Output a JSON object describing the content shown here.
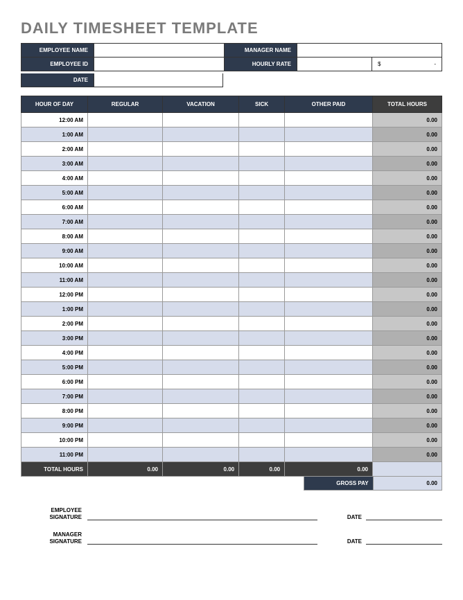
{
  "title": "DAILY TIMESHEET TEMPLATE",
  "info": {
    "employeeNameLabel": "EMPLOYEE NAME",
    "employeeName": "",
    "managerNameLabel": "MANAGER NAME",
    "managerName": "",
    "employeeIdLabel": "EMPLOYEE ID",
    "employeeId": "",
    "hourlyRateLabel": "HOURLY RATE",
    "hourlyRateSymbol": "$",
    "hourlyRateDash": "-",
    "dateLabel": "DATE",
    "date": ""
  },
  "columns": {
    "hour": "HOUR OF DAY",
    "regular": "REGULAR",
    "vacation": "VACATION",
    "sick": "SICK",
    "other": "OTHER PAID",
    "total": "TOTAL HOURS"
  },
  "rows": [
    {
      "hour": "12:00 AM",
      "reg": "",
      "vac": "",
      "sick": "",
      "other": "",
      "total": "0.00"
    },
    {
      "hour": "1:00 AM",
      "reg": "",
      "vac": "",
      "sick": "",
      "other": "",
      "total": "0.00"
    },
    {
      "hour": "2:00 AM",
      "reg": "",
      "vac": "",
      "sick": "",
      "other": "",
      "total": "0.00"
    },
    {
      "hour": "3:00 AM",
      "reg": "",
      "vac": "",
      "sick": "",
      "other": "",
      "total": "0.00"
    },
    {
      "hour": "4:00 AM",
      "reg": "",
      "vac": "",
      "sick": "",
      "other": "",
      "total": "0.00"
    },
    {
      "hour": "5:00 AM",
      "reg": "",
      "vac": "",
      "sick": "",
      "other": "",
      "total": "0.00"
    },
    {
      "hour": "6:00 AM",
      "reg": "",
      "vac": "",
      "sick": "",
      "other": "",
      "total": "0.00"
    },
    {
      "hour": "7:00 AM",
      "reg": "",
      "vac": "",
      "sick": "",
      "other": "",
      "total": "0.00"
    },
    {
      "hour": "8:00 AM",
      "reg": "",
      "vac": "",
      "sick": "",
      "other": "",
      "total": "0.00"
    },
    {
      "hour": "9:00 AM",
      "reg": "",
      "vac": "",
      "sick": "",
      "other": "",
      "total": "0.00"
    },
    {
      "hour": "10:00 AM",
      "reg": "",
      "vac": "",
      "sick": "",
      "other": "",
      "total": "0.00"
    },
    {
      "hour": "11:00 AM",
      "reg": "",
      "vac": "",
      "sick": "",
      "other": "",
      "total": "0.00"
    },
    {
      "hour": "12:00 PM",
      "reg": "",
      "vac": "",
      "sick": "",
      "other": "",
      "total": "0.00"
    },
    {
      "hour": "1:00 PM",
      "reg": "",
      "vac": "",
      "sick": "",
      "other": "",
      "total": "0.00"
    },
    {
      "hour": "2:00 PM",
      "reg": "",
      "vac": "",
      "sick": "",
      "other": "",
      "total": "0.00"
    },
    {
      "hour": "3:00 PM",
      "reg": "",
      "vac": "",
      "sick": "",
      "other": "",
      "total": "0.00"
    },
    {
      "hour": "4:00 PM",
      "reg": "",
      "vac": "",
      "sick": "",
      "other": "",
      "total": "0.00"
    },
    {
      "hour": "5:00 PM",
      "reg": "",
      "vac": "",
      "sick": "",
      "other": "",
      "total": "0.00"
    },
    {
      "hour": "6:00 PM",
      "reg": "",
      "vac": "",
      "sick": "",
      "other": "",
      "total": "0.00"
    },
    {
      "hour": "7:00 PM",
      "reg": "",
      "vac": "",
      "sick": "",
      "other": "",
      "total": "0.00"
    },
    {
      "hour": "8:00 PM",
      "reg": "",
      "vac": "",
      "sick": "",
      "other": "",
      "total": "0.00"
    },
    {
      "hour": "9:00 PM",
      "reg": "",
      "vac": "",
      "sick": "",
      "other": "",
      "total": "0.00"
    },
    {
      "hour": "10:00 PM",
      "reg": "",
      "vac": "",
      "sick": "",
      "other": "",
      "total": "0.00"
    },
    {
      "hour": "11:00 PM",
      "reg": "",
      "vac": "",
      "sick": "",
      "other": "",
      "total": "0.00"
    }
  ],
  "totals": {
    "label": "TOTAL HOURS",
    "reg": "0.00",
    "vac": "0.00",
    "sick": "0.00",
    "other": "0.00",
    "total": ""
  },
  "gross": {
    "label": "GROSS PAY",
    "value": "0.00"
  },
  "signatures": {
    "employeeLabel": "EMPLOYEE SIGNATURE",
    "managerLabel": "MANAGER SIGNATURE",
    "dateLabel": "DATE"
  }
}
